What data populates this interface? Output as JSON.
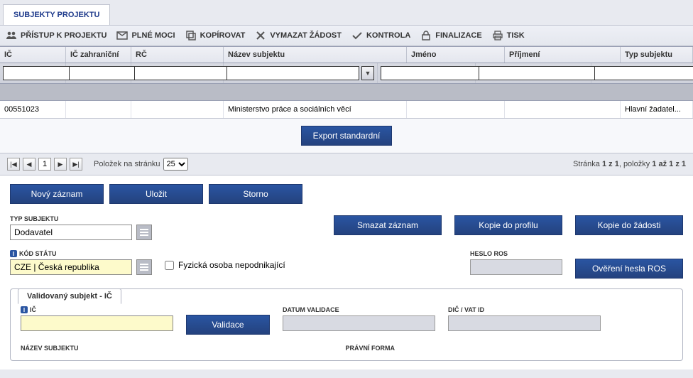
{
  "tab_title": "SUBJEKTY PROJEKTU",
  "toolbar": [
    {
      "id": "pristup",
      "label": "PŘÍSTUP K PROJEKTU"
    },
    {
      "id": "plne-moci",
      "label": "PLNÉ MOCI"
    },
    {
      "id": "kopirovat",
      "label": "KOPÍROVAT"
    },
    {
      "id": "vymazat",
      "label": "VYMAZAT ŽÁDOST"
    },
    {
      "id": "kontrola",
      "label": "KONTROLA"
    },
    {
      "id": "finalizace",
      "label": "FINALIZACE"
    },
    {
      "id": "tisk",
      "label": "TISK"
    }
  ],
  "grid": {
    "headers": [
      "IČ",
      "IČ zahraniční",
      "RČ",
      "Název subjektu",
      "Jméno",
      "Příjmení",
      "Typ subjektu"
    ],
    "row": {
      "ic": "00551023",
      "nazev": "Ministerstvo práce a sociálních věcí",
      "typ": "Hlavní žadatel..."
    }
  },
  "export_btn": "Export standardní",
  "pager": {
    "page": "1",
    "items_label": "Položek na stránku",
    "items_value": "25",
    "summary_left": "Stránka ",
    "summary_mid": "1 z 1",
    "summary_right": ", položky ",
    "summary_end": "1 až 1 z 1"
  },
  "actions": {
    "novy": "Nový záznam",
    "ulozit": "Uložit",
    "storno": "Storno"
  },
  "right_actions": {
    "smazat": "Smazat záznam",
    "kopie_profil": "Kopie do profilu",
    "kopie_zadost": "Kopie do žádosti"
  },
  "typ_subjektu": {
    "label": "TYP SUBJEKTU",
    "value": "Dodavatel"
  },
  "kod_statu": {
    "label": "KÓD STÁTU",
    "value": "CZE | Česká republika"
  },
  "fyzicka_check": "Fyzická osoba nepodnikající",
  "heslo_ros": {
    "label": "HESLO ROS",
    "button": "Ověření hesla ROS"
  },
  "val_box": {
    "title": "Validovaný subjekt - IČ",
    "ic_label": "IČ",
    "validace": "Validace",
    "datum_label": "DATUM VALIDACE",
    "dic_label": "DIČ / VAT ID",
    "nazev_label": "NÁZEV SUBJEKTU",
    "pravni_label": "PRÁVNÍ FORMA"
  }
}
